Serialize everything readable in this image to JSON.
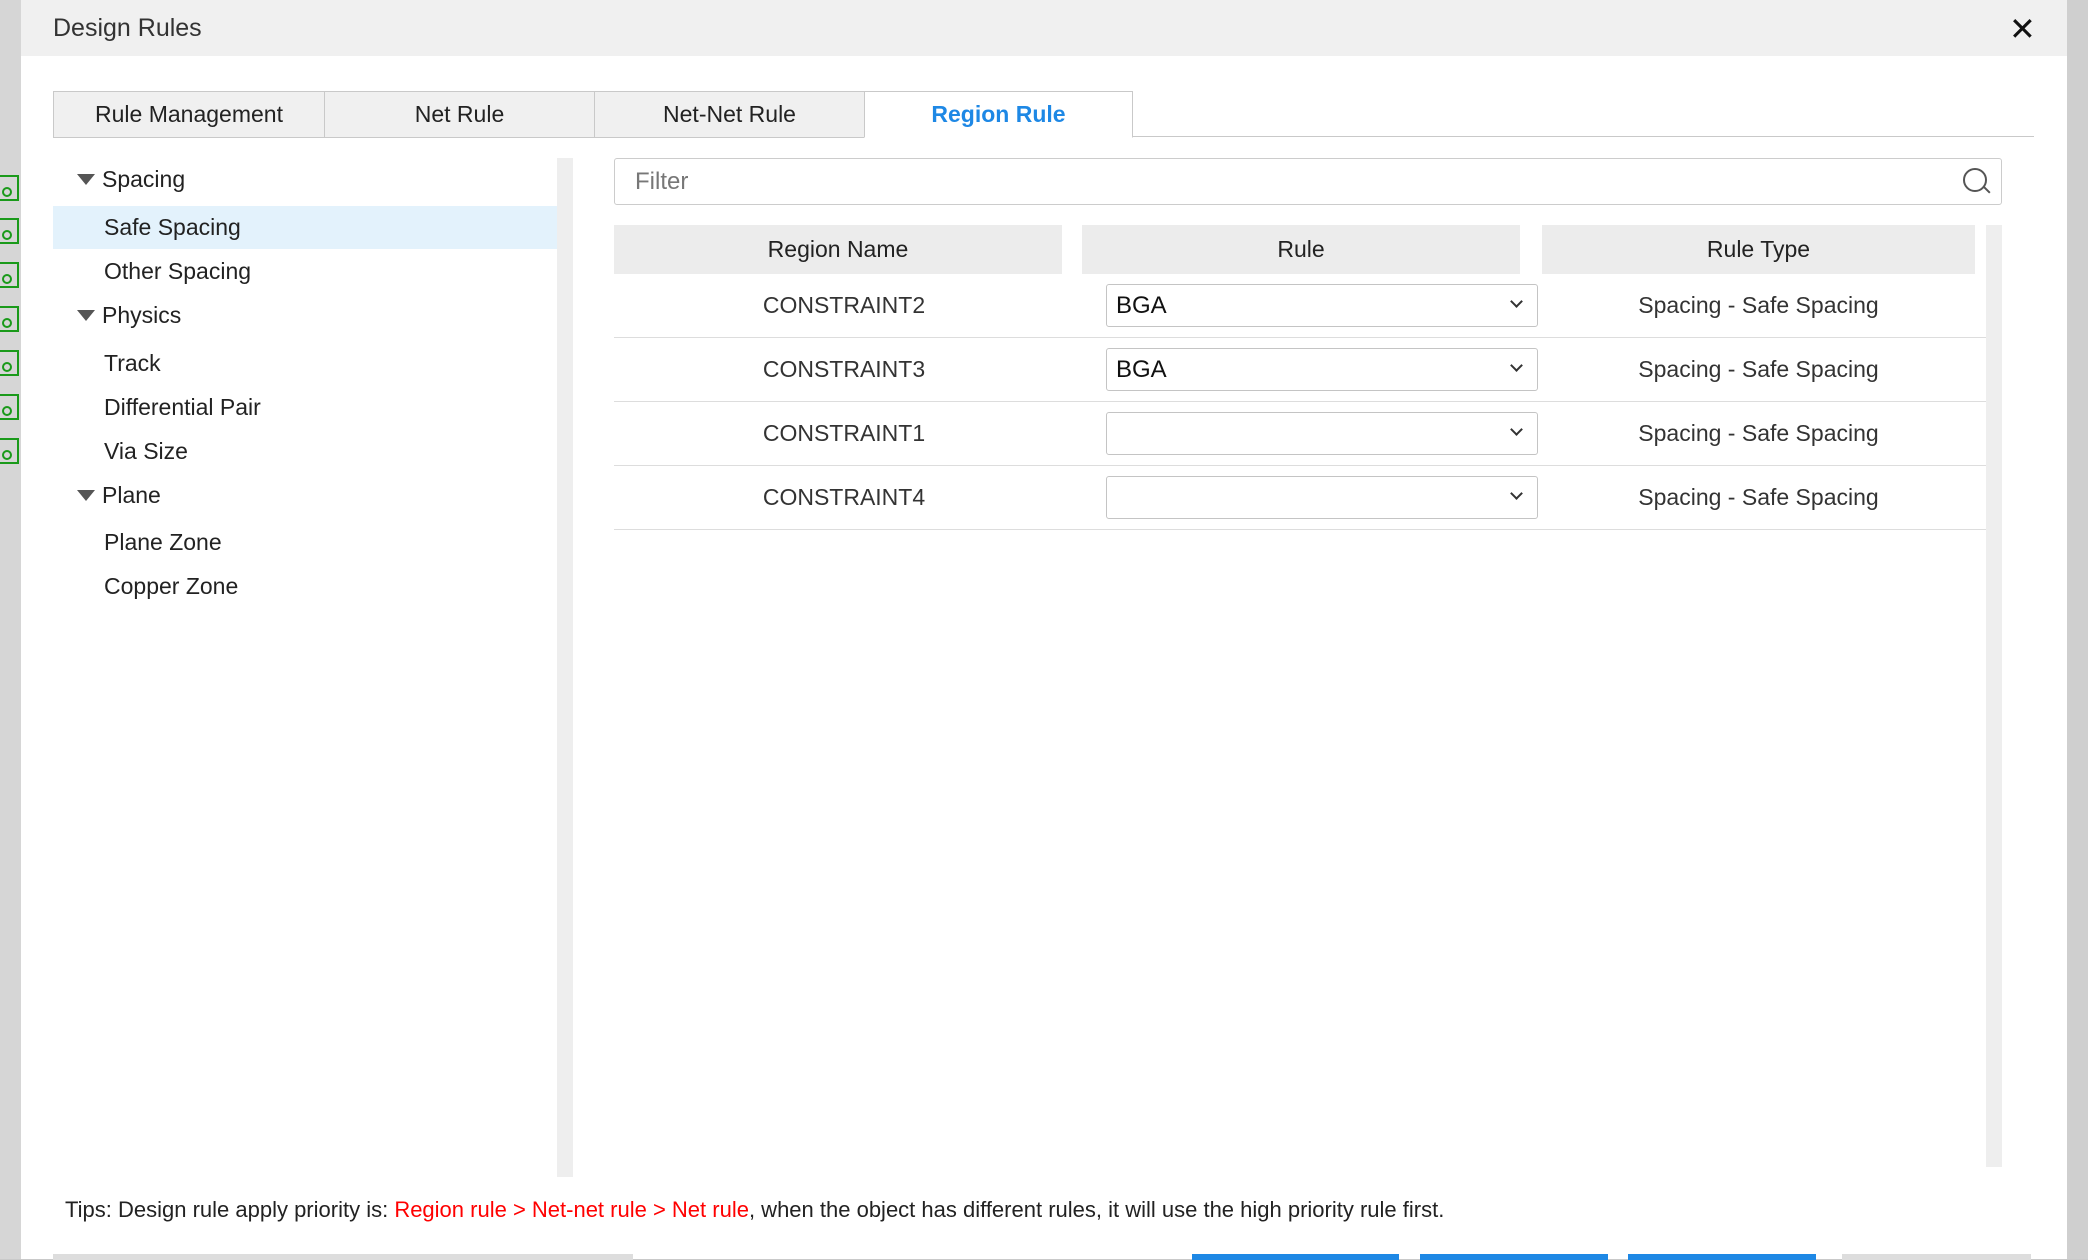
{
  "dialog": {
    "title": "Design Rules",
    "close_icon": "close-icon"
  },
  "tabs": [
    {
      "label": "Rule Management"
    },
    {
      "label": "Net Rule"
    },
    {
      "label": "Net-Net Rule"
    },
    {
      "label": "Region Rule",
      "active": true
    }
  ],
  "tree": {
    "spacing": "Spacing",
    "safe_spacing": "Safe Spacing",
    "other_spacing": "Other Spacing",
    "physics": "Physics",
    "track": "Track",
    "differential_pair": "Differential Pair",
    "via_size": "Via Size",
    "plane": "Plane",
    "plane_zone": "Plane Zone",
    "copper_zone": "Copper Zone"
  },
  "filter": {
    "placeholder": "Filter",
    "value": ""
  },
  "table": {
    "headers": [
      "Region Name",
      "Rule",
      "Rule Type"
    ],
    "rows": [
      {
        "region": "CONSTRAINT2",
        "rule": "BGA",
        "type": "Spacing - Safe Spacing"
      },
      {
        "region": "CONSTRAINT3",
        "rule": "BGA",
        "type": "Spacing - Safe Spacing"
      },
      {
        "region": "CONSTRAINT1",
        "rule": "",
        "type": "Spacing - Safe Spacing"
      },
      {
        "region": "CONSTRAINT4",
        "rule": "",
        "type": "Spacing - Safe Spacing"
      }
    ]
  },
  "tips": {
    "prefix": "Tips: Design rule apply priority is: ",
    "priority": "Region rule > Net-net rule > Net rule",
    "suffix": ", when the object has different rules, it will use the high priority rule first."
  },
  "colors": {
    "accent": "#1e88e5",
    "priority": "#ff0000",
    "selected_bg": "#e3f2fc"
  }
}
